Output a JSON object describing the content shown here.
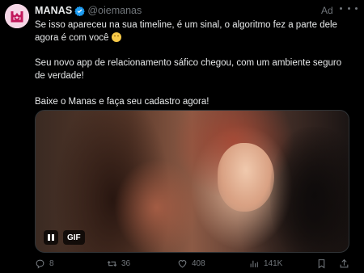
{
  "account": {
    "name": "MANAS",
    "handle": "@oiemanas",
    "ad_label": "Ad"
  },
  "tweet": {
    "line1": "Se isso apareceu na sua timeline, é um sinal, o algoritmo fez a parte dele agora é com você",
    "paragraph2": "Seu novo app de relacionamento sáfico chegou, com um ambiente seguro de verdade!",
    "paragraph3": "Baixe o Manas e faça seu cadastro agora!"
  },
  "media": {
    "badge": "GIF"
  },
  "actions": {
    "replies": "8",
    "reposts": "36",
    "likes": "408",
    "views": "141K"
  },
  "colors": {
    "background": "#000000",
    "text": "#e7e9ea",
    "muted": "#71767b",
    "verified": "#1d9bf0",
    "avatar_bg": "#f6d6e6",
    "avatar_accent": "#c2185b"
  },
  "icons": [
    "verified-badge-icon",
    "more-icon",
    "pause-icon",
    "reply-icon",
    "repost-icon",
    "like-icon",
    "views-icon",
    "bookmark-icon",
    "share-icon"
  ]
}
